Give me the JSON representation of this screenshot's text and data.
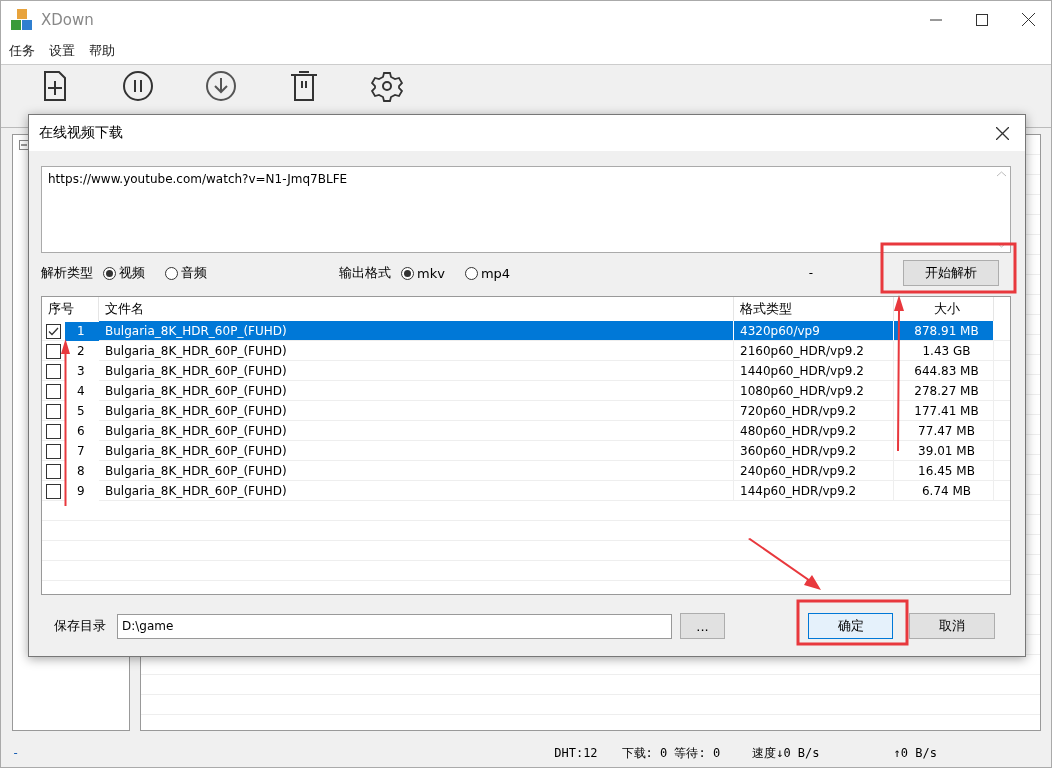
{
  "window": {
    "title": "XDown"
  },
  "menu": [
    {
      "label": "任务"
    },
    {
      "label": "设置"
    },
    {
      "label": "帮助"
    }
  ],
  "toolbar": [
    {
      "kind": "new"
    },
    {
      "kind": "pause"
    },
    {
      "kind": "resume"
    },
    {
      "kind": "delete"
    },
    {
      "kind": "settings"
    }
  ],
  "dialog": {
    "title": "在线视频下载",
    "url": "https://www.youtube.com/watch?v=N1-Jmq7BLFE",
    "parse_type": {
      "label": "解析类型",
      "options": [
        {
          "label": "视频",
          "selected": true
        },
        {
          "label": "音频",
          "selected": false
        }
      ]
    },
    "output_format": {
      "label": "输出格式",
      "options": [
        {
          "label": "mkv",
          "selected": true
        },
        {
          "label": "mp4",
          "selected": false
        }
      ]
    },
    "status": "-",
    "parse_button": "开始解析",
    "table": {
      "columns": [
        "序号",
        "文件名",
        "格式类型",
        "大小"
      ],
      "rows": [
        {
          "checked": true,
          "selected": true,
          "index": "1",
          "name": "Bulgaria_8K_HDR_60P_(FUHD)",
          "format": "4320p60/vp9",
          "size": "878.91 MB"
        },
        {
          "checked": false,
          "selected": false,
          "index": "2",
          "name": "Bulgaria_8K_HDR_60P_(FUHD)",
          "format": "2160p60_HDR/vp9.2",
          "size": "1.43 GB"
        },
        {
          "checked": false,
          "selected": false,
          "index": "3",
          "name": "Bulgaria_8K_HDR_60P_(FUHD)",
          "format": "1440p60_HDR/vp9.2",
          "size": "644.83 MB"
        },
        {
          "checked": false,
          "selected": false,
          "index": "4",
          "name": "Bulgaria_8K_HDR_60P_(FUHD)",
          "format": "1080p60_HDR/vp9.2",
          "size": "278.27 MB"
        },
        {
          "checked": false,
          "selected": false,
          "index": "5",
          "name": "Bulgaria_8K_HDR_60P_(FUHD)",
          "format": "720p60_HDR/vp9.2",
          "size": "177.41 MB"
        },
        {
          "checked": false,
          "selected": false,
          "index": "6",
          "name": "Bulgaria_8K_HDR_60P_(FUHD)",
          "format": "480p60_HDR/vp9.2",
          "size": "77.47 MB"
        },
        {
          "checked": false,
          "selected": false,
          "index": "7",
          "name": "Bulgaria_8K_HDR_60P_(FUHD)",
          "format": "360p60_HDR/vp9.2",
          "size": "39.01 MB"
        },
        {
          "checked": false,
          "selected": false,
          "index": "8",
          "name": "Bulgaria_8K_HDR_60P_(FUHD)",
          "format": "240p60_HDR/vp9.2",
          "size": "16.45 MB"
        },
        {
          "checked": false,
          "selected": false,
          "index": "9",
          "name": "Bulgaria_8K_HDR_60P_(FUHD)",
          "format": "144p60_HDR/vp9.2",
          "size": "6.74 MB"
        }
      ]
    },
    "save_dir": {
      "label": "保存目录",
      "value": "D:\\game"
    },
    "browse_button": "...",
    "ok_button": "确定",
    "cancel_button": "取消"
  },
  "status_bar": {
    "left": "-",
    "dht": "DHT:12",
    "queue": "下载: 0 等待: 0",
    "down": "速度↓0 B/s",
    "up": "↑0 B/s"
  }
}
